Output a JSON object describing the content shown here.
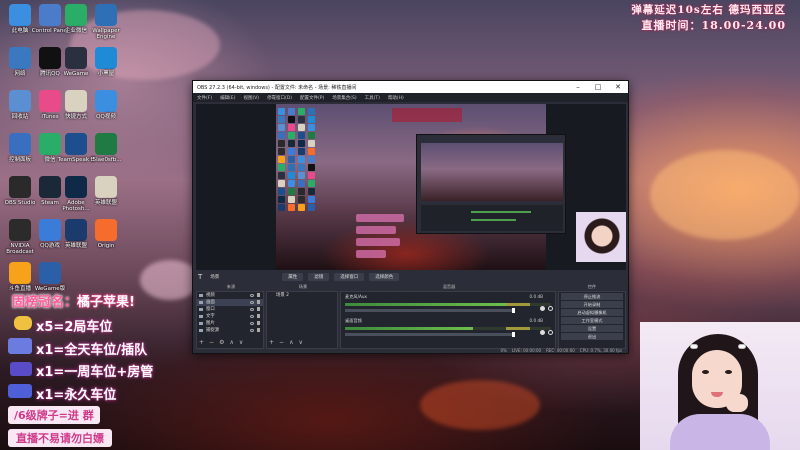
{
  "overlay": {
    "line1": "弹幕延迟10s左右  德玛西亚区",
    "line2": "直播时间：18.00-24.00"
  },
  "desktop": {
    "icons": [
      {
        "label": "此电脑",
        "icon": "computer-icon",
        "color": "#3b8ee0"
      },
      {
        "label": "Control Panel",
        "icon": "control-panel-icon",
        "color": "#4a7cc9"
      },
      {
        "label": "企业微信",
        "icon": "wecom-icon",
        "color": "#2aae67"
      },
      {
        "label": "Wallpaper Engine",
        "icon": "wallpaper-engine-icon",
        "color": "#2f6fb5"
      },
      {
        "label": "网络",
        "icon": "network-icon",
        "color": "#3a78c0"
      },
      {
        "label": "腾讯QQ",
        "icon": "qq-icon",
        "color": "#111111"
      },
      {
        "label": "WeGame",
        "icon": "wegame-icon",
        "color": "#2b3040"
      },
      {
        "label": "小黑屋",
        "icon": "edge-icon",
        "color": "#1f8bd6"
      },
      {
        "label": "回收站",
        "icon": "recycle-bin-icon",
        "color": "#5b8fd1"
      },
      {
        "label": "iTunes",
        "icon": "itunes-icon",
        "color": "#e84a8a"
      },
      {
        "label": "快捷方式",
        "icon": "file-icon",
        "color": "#d9d2c0"
      },
      {
        "label": "QQ视频",
        "icon": "qq-video-icon",
        "color": "#3b8ee0"
      },
      {
        "label": "控制面板",
        "icon": "control-icon",
        "color": "#3a6fc0"
      },
      {
        "label": "微信",
        "icon": "wechat-icon",
        "color": "#2aae67"
      },
      {
        "label": "TeamSpeak 3",
        "icon": "teamspeak-icon",
        "color": "#1d4f8f"
      },
      {
        "label": "t5lae0sfb...",
        "icon": "excel-icon",
        "color": "#1f7a44"
      },
      {
        "label": "OBS Studio",
        "icon": "obs-icon",
        "color": "#2a2a2a"
      },
      {
        "label": "Steam",
        "icon": "steam-icon",
        "color": "#1b2838"
      },
      {
        "label": "Adobe Photosh...",
        "icon": "photoshop-icon",
        "color": "#0e2a47"
      },
      {
        "label": "英雄联盟",
        "icon": "file-icon",
        "color": "#d9d2c0"
      },
      {
        "label": "NVIDIA Broadcast",
        "icon": "nvidia-icon",
        "color": "#2b2b2b"
      },
      {
        "label": "QQ游戏",
        "icon": "qq-game-icon",
        "color": "#3b7cd9"
      },
      {
        "label": "英雄联盟",
        "icon": "lol-icon",
        "color": "#1a3b6b"
      },
      {
        "label": "Origin",
        "icon": "origin-icon",
        "color": "#f56c2d"
      },
      {
        "label": "斗鱼直播",
        "icon": "douyu-icon",
        "color": "#f7a21b"
      },
      {
        "label": "WeGame版",
        "icon": "wegame-box-icon",
        "color": "#2b5fa8"
      }
    ]
  },
  "obs": {
    "title": "OBS 27.2.3 (64-bit, windows) - 配置文件: 未命名 - 场景: 稀铁直播间",
    "menu": [
      "文件(F)",
      "编辑(E)",
      "视图(V)",
      "停靠窗口(D)",
      "配置文件(P)",
      "场景集合(S)",
      "工具(T)",
      "帮助(H)"
    ],
    "toolbar": {
      "scene": "场景",
      "properties": "属性",
      "filters": "滤镜",
      "select_window": "选择窗口",
      "pick_color": "选择颜色"
    },
    "docks": {
      "scenes": "来源",
      "sources": "场景",
      "mixer": "混音器",
      "transitions": "场景过渡",
      "controls": "控件"
    },
    "scenes": [
      "视频",
      "画面",
      "窗口",
      "文字",
      "图片",
      "捕捉源"
    ],
    "sources": [
      "场景 2"
    ],
    "mixer": [
      {
        "name": "麦克风/Aux",
        "db": "0.0 dB",
        "level": 0.78
      },
      {
        "name": "桌面音频",
        "db": "0.0 dB",
        "level": 0.62
      }
    ],
    "controls": [
      "停止推流",
      "开始录制",
      "启动虚拟摄像机",
      "工作室模式",
      "设置",
      "退出"
    ],
    "status": [
      "0%",
      "LIVE: 00:00:00",
      "REC: 00:00:00",
      "CPU: 0.7%, 30.00 fps"
    ]
  },
  "banners": {
    "title_prefix": "固榜冠名：",
    "title_name": "橘子苹果!",
    "lines": [
      "x5=2局车位",
      "x1=全天车位/插队",
      "x1=一周车位+房管",
      "x1=永久车位"
    ],
    "pill1": "/6级牌子=进  群",
    "pill2": "直播不易请勿白嫖"
  }
}
